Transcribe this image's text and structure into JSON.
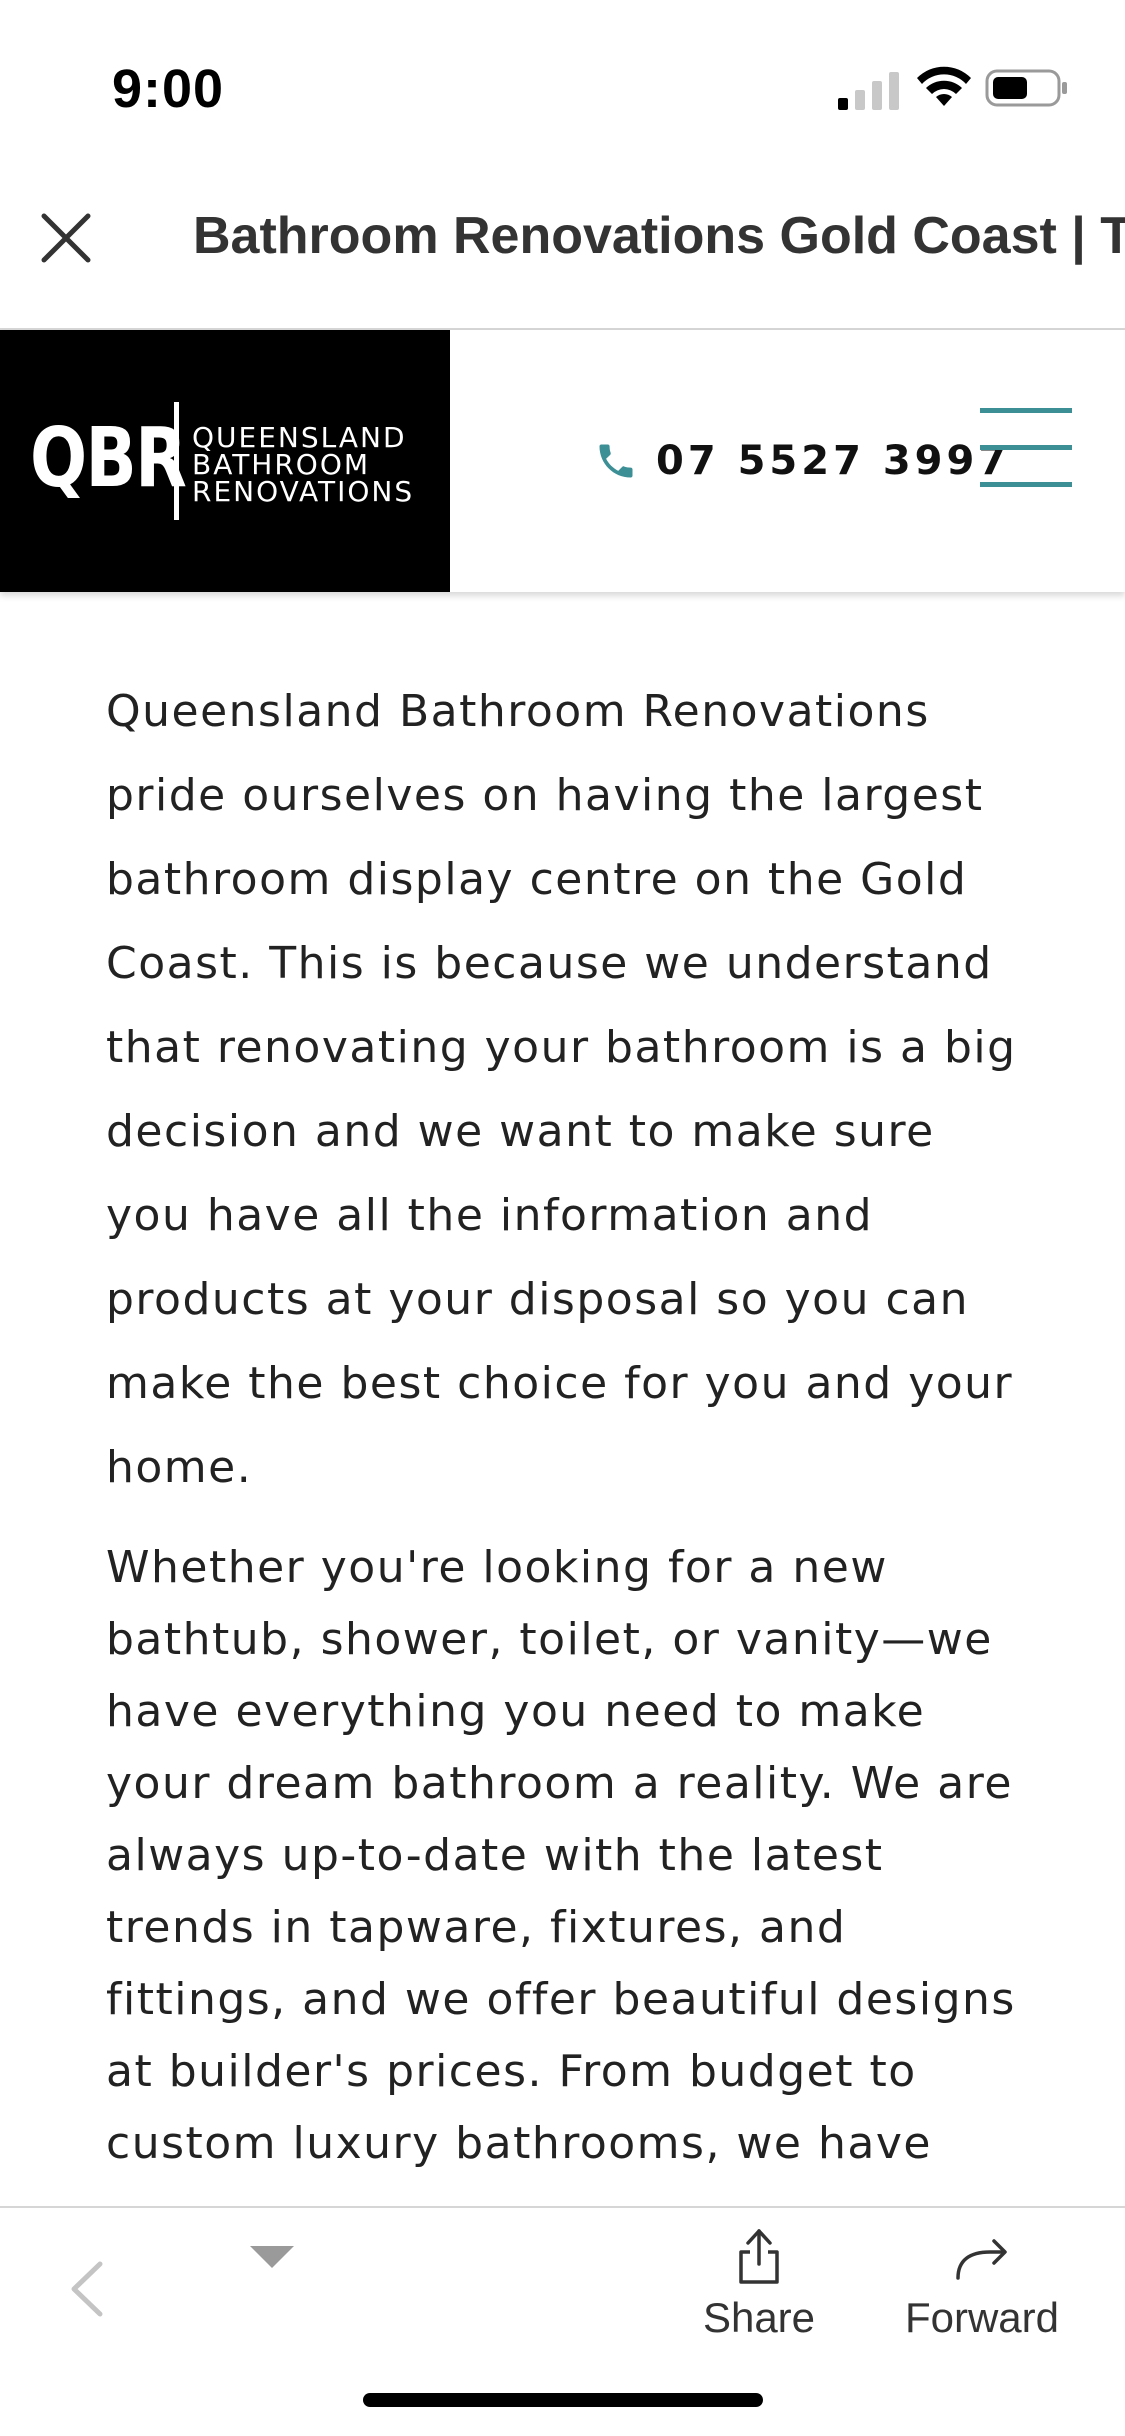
{
  "status_bar": {
    "time": "9:00",
    "icons": [
      "cellular-signal-icon",
      "wifi-icon",
      "battery-icon"
    ]
  },
  "browser": {
    "close_icon": "close-icon",
    "page_title": "Bathroom Renovations Gold Coast | T"
  },
  "site_header": {
    "logo": {
      "abbr": "QBR",
      "line1": "QUEENSLAND",
      "line2": "BATHROOM",
      "line3": "RENOVATIONS"
    },
    "phone_icon": "phone-icon",
    "phone_number": "07 5527 3997",
    "menu_icon": "hamburger-menu-icon",
    "accent_color": "#3d8f96"
  },
  "content": {
    "paragraph1": "Queensland Bathroom Renovations pride ourselves on having the largest bathroom display centre on the Gold Coast. This is because we understand that renovating your bathroom is a big decision and we want to make sure you have all the information and products at your disposal so you can make the best choice for you and your home.",
    "paragraph2": "Whether you're looking for a new bathtub, shower, toilet, or vanity—we have everything you need to make your dream bathroom a reality. We are always up-to-date with the latest trends in tapware, fixtures, and fittings, and we offer beautiful designs at builder's prices. From budget to custom luxury bathrooms, we have"
  },
  "toolbar": {
    "back_icon": "chevron-left-icon",
    "dropdown_icon": "triangle-down-icon",
    "share_label": "Share",
    "forward_label": "Forward"
  }
}
